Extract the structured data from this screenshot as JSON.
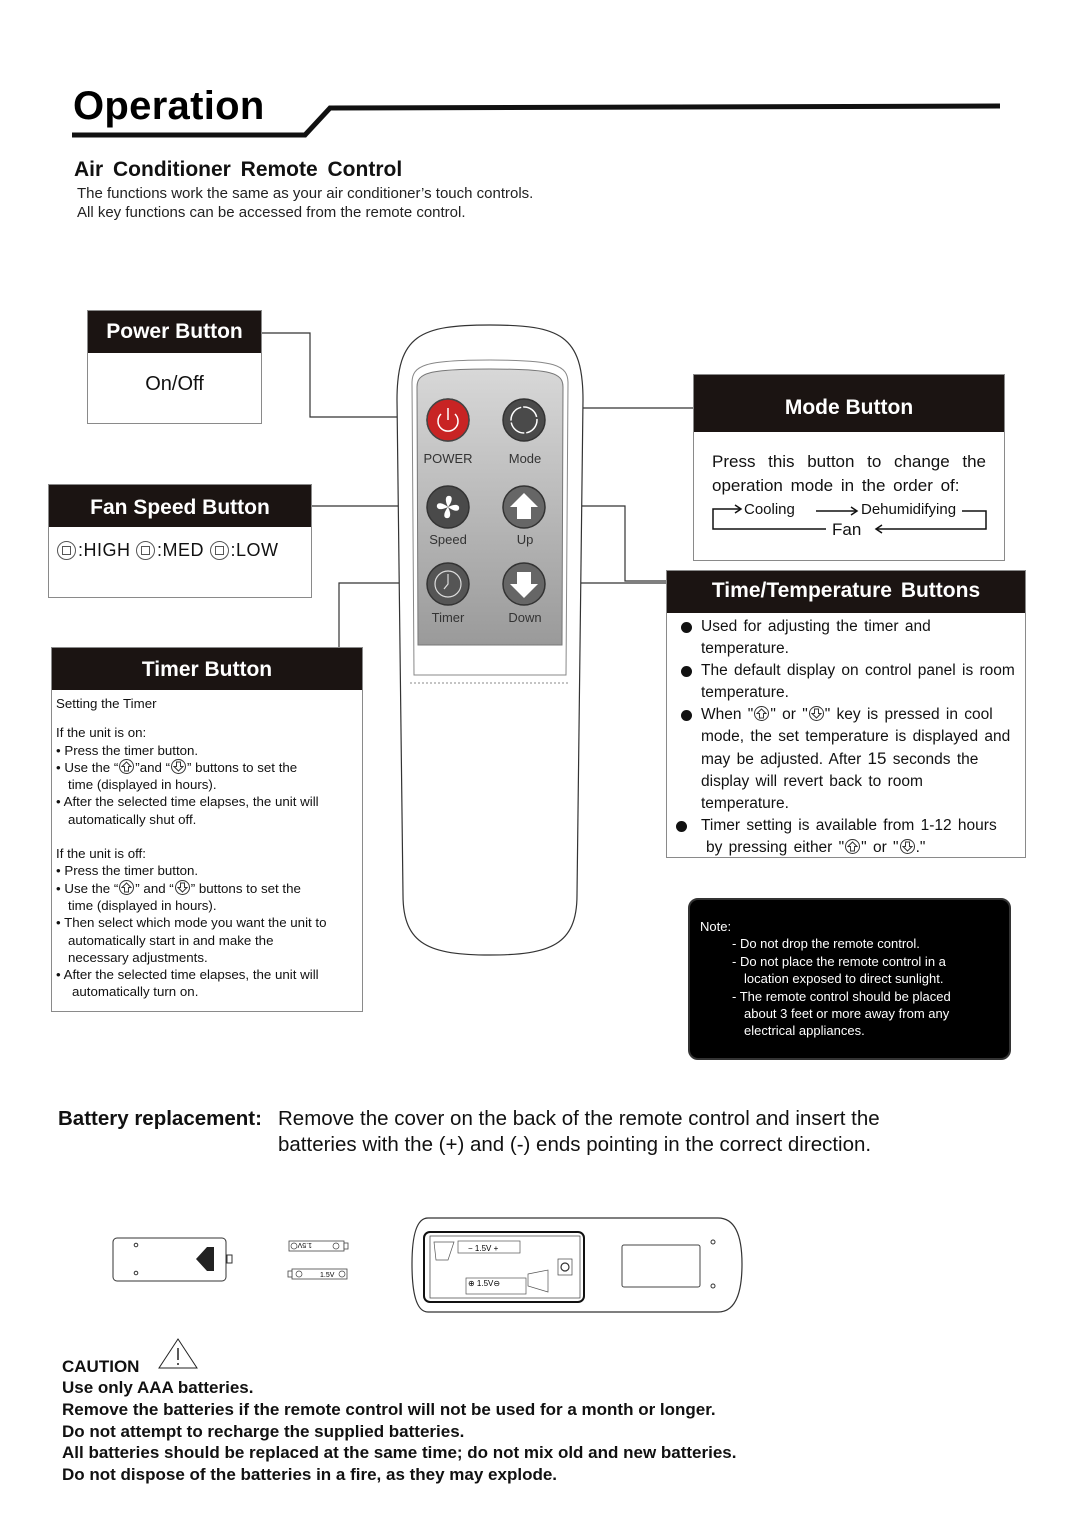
{
  "page": {
    "title": "Operation",
    "subtitle": "Air  Conditioner  Remote  Control",
    "intro": [
      "The functions work the same as your air conditioner’s touch controls.",
      "All key functions can be accessed from the remote control."
    ]
  },
  "remote": {
    "buttons": [
      {
        "id": "power",
        "label": "POWER",
        "icon": "power-icon",
        "color": "#d42a2a"
      },
      {
        "id": "mode",
        "label": "Mode",
        "icon": "cycle-icon",
        "color": "#555555"
      },
      {
        "id": "speed",
        "label": "Speed",
        "icon": "fan-icon",
        "color": "#555555"
      },
      {
        "id": "up",
        "label": "Up",
        "icon": "arrow-up-icon",
        "color": "#666666"
      },
      {
        "id": "timer",
        "label": "Timer",
        "icon": "clock-icon",
        "color": "#555555"
      },
      {
        "id": "down",
        "label": "Down",
        "icon": "arrow-down-icon",
        "color": "#666666"
      }
    ]
  },
  "power_box": {
    "title": "Power Button",
    "body": "On/Off"
  },
  "fan_box": {
    "title": "Fan Speed Button",
    "levels": [
      ":HIGH",
      ":MED",
      ":LOW"
    ]
  },
  "timer_box": {
    "title": "Timer Button",
    "heading": "Setting the Timer",
    "on_heading": "If the unit is on:",
    "on_1": "• Press the timer button.",
    "on_2a": "• Use the “",
    "on_2b": "”and “",
    "on_2c": "” buttons to set the",
    "on_2d": "time (displayed in hours).",
    "on_3a": "• After the selected time elapses, the unit will",
    "on_3b": "automatically shut off.",
    "off_heading": "If the unit is off:",
    "off_1": "• Press the timer button.",
    "off_2a": "• Use the “",
    "off_2b": "” and “",
    "off_2c": "” buttons to set the",
    "off_2d": "time (displayed in hours).",
    "off_3a": "• Then select which mode you want the unit to",
    "off_3b": "automatically start in and make the",
    "off_3c": "necessary adjustments.",
    "off_4a": "•  After the selected time elapses, the unit will",
    "off_4b": "automatically turn on."
  },
  "mode_box": {
    "title": "Mode Button",
    "body": "Press this button to change the operation mode in the order of:",
    "cycle": [
      "Cooling",
      "Dehumidifying",
      "Fan"
    ]
  },
  "tt_box": {
    "title": "Time/Temperature  Buttons",
    "item1": "Used  for  adjusting  the  timer  and temperature.",
    "item2": "The  default  display  on  control  panel  is room  temperature.",
    "item3a": "When  \"",
    "item3b": "\" or  \"",
    "item3c": "\" key  is  pressed in cool  mode,  the  set  temperature  is displayed  and  may  be  adjusted.  After",
    "item3d": "15",
    "item3e": "seconds  the display  will  revert  back to  room  temperature.",
    "item4a": "Timer setting is available from 1-12 hours",
    "item4b": "by pressing  either  \"",
    "item4c": "\"  or \"",
    "item4d": ".\""
  },
  "note_box": {
    "label": "Note:",
    "items": [
      "- Do not drop the remote control.",
      "- Do not place the remote control in a",
      "location exposed to direct sunlight.",
      "- The remote control should be placed",
      "about 3 feet or more away from any",
      "electrical appliances."
    ]
  },
  "battery": {
    "label": "Battery replacement:",
    "line1": "Remove the cover on the back of the remote control and insert the",
    "line2": "batteries with the (+) and (-) ends pointing in the correct direction.",
    "battery_voltage": "1.5V"
  },
  "caution": {
    "label": "CAUTION",
    "lines": [
      "Use only AAA batteries.",
      "Remove the batteries if the remote control will not be used for a month or longer.",
      "Do not attempt to recharge the supplied batteries.",
      "All batteries should be replaced at the same time; do not mix old and new batteries.",
      "Do not dispose of the batteries in a fire, as they may explode."
    ]
  }
}
